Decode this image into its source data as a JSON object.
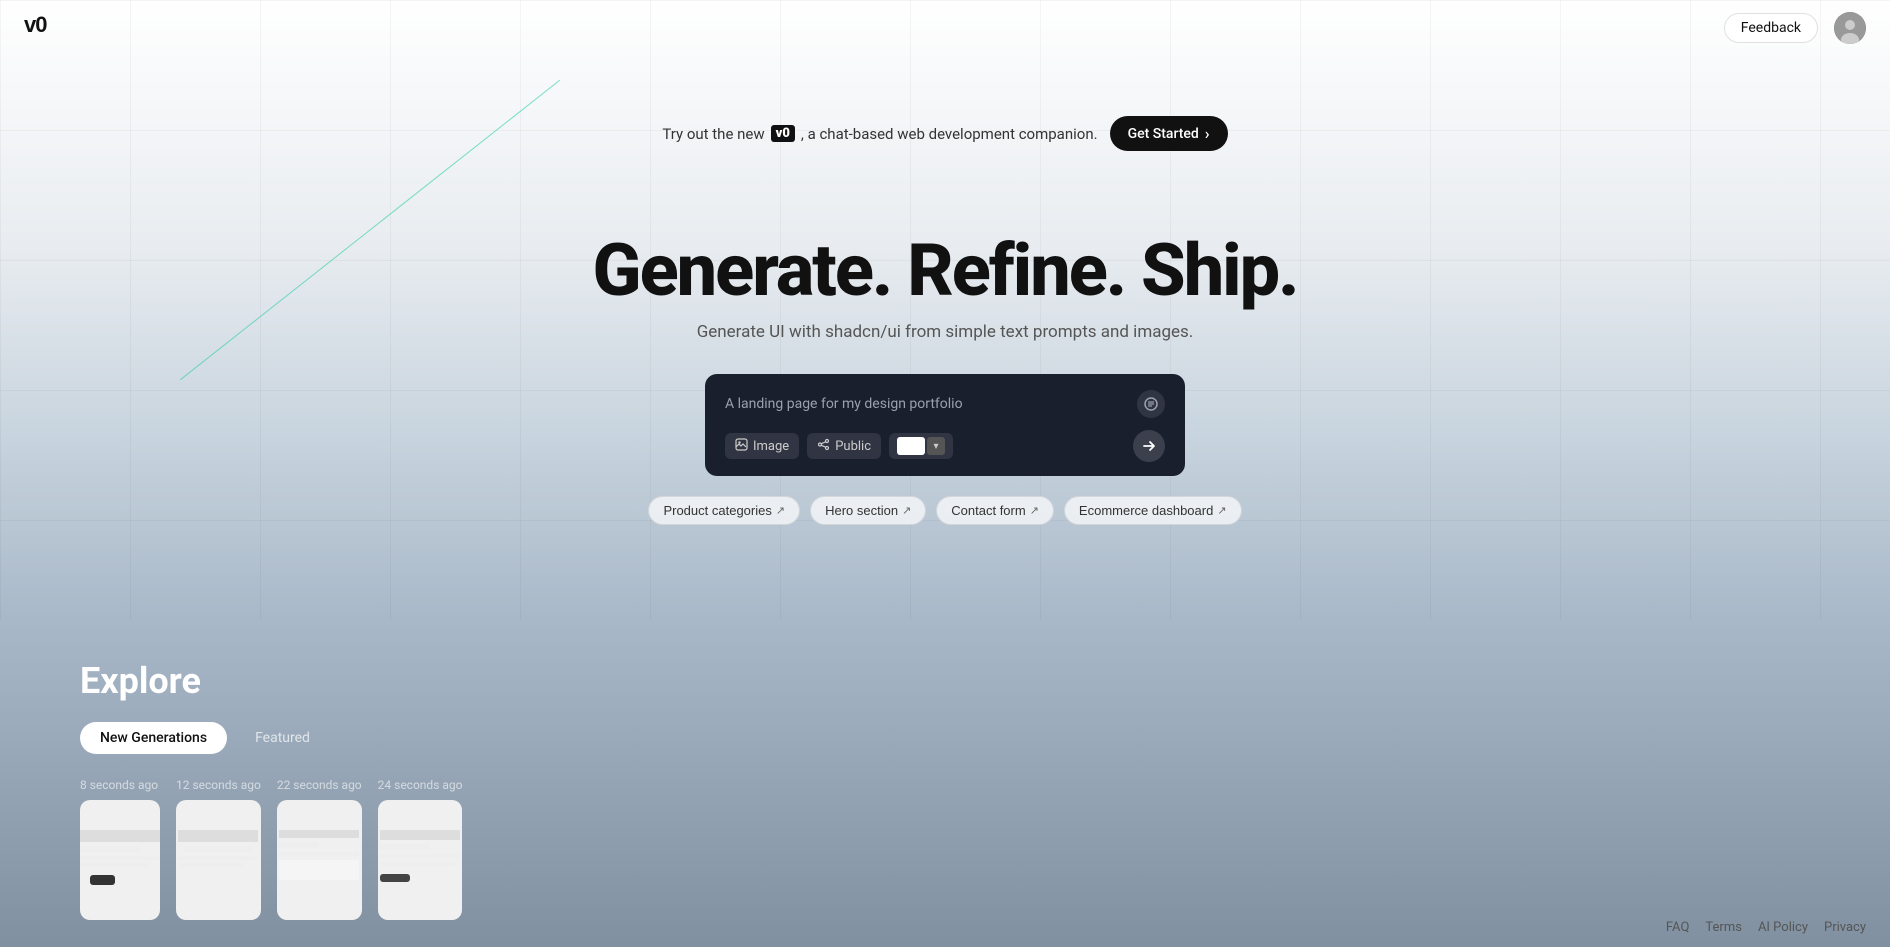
{
  "header": {
    "logo": "v0",
    "feedback_label": "Feedback"
  },
  "banner": {
    "text_before": "Try out the new",
    "logo": "v0",
    "text_after": ", a chat-based web development companion.",
    "cta_label": "Get Started"
  },
  "hero": {
    "headline": "Generate. Refine. Ship.",
    "subheadline": "Generate UI with shadcn/ui from simple text prompts and images."
  },
  "prompt": {
    "placeholder": "A landing page for my design portfolio",
    "image_btn": "Image",
    "visibility_btn": "Public"
  },
  "suggestions": [
    {
      "label": "Product categories"
    },
    {
      "label": "Hero section"
    },
    {
      "label": "Contact form"
    },
    {
      "label": "Ecommerce dashboard"
    }
  ],
  "explore": {
    "title": "Explore",
    "tabs": [
      {
        "label": "New Generations",
        "active": true
      },
      {
        "label": "Featured",
        "active": false
      }
    ],
    "cards": [
      {
        "timestamp": "8 seconds ago"
      },
      {
        "timestamp": "12 seconds ago"
      },
      {
        "timestamp": "22 seconds ago"
      },
      {
        "timestamp": "24 seconds ago"
      }
    ]
  },
  "footer": {
    "links": [
      "FAQ",
      "Terms",
      "AI Policy",
      "Privacy"
    ]
  }
}
